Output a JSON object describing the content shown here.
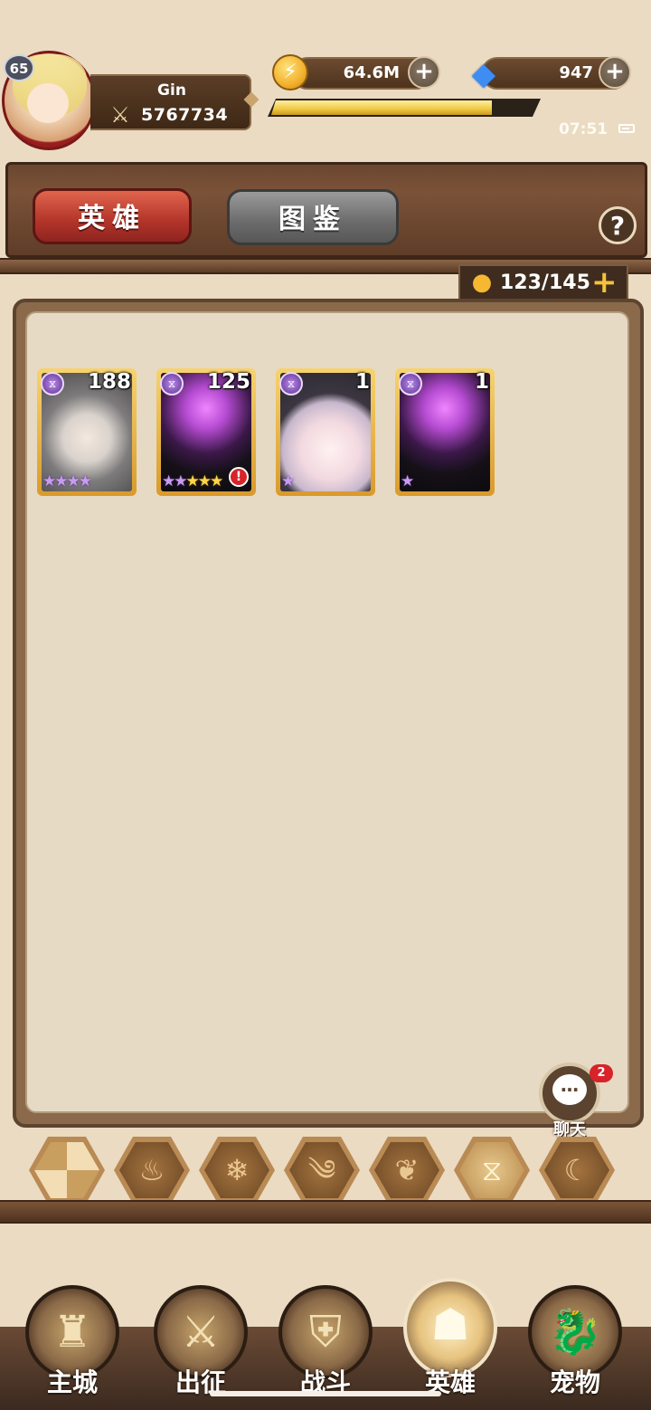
{
  "player": {
    "level": "65",
    "name": "Gin",
    "power": "5767734"
  },
  "currency": {
    "gold": "64.6M",
    "gems": "947"
  },
  "energy": {
    "fill_fraction": 0.84,
    "bar_color": "#f0c842"
  },
  "status": {
    "time": "07:51"
  },
  "tabs": [
    {
      "label": "英雄",
      "active": true
    },
    {
      "label": "图鉴",
      "active": false
    }
  ],
  "help_label": "?",
  "hero_count": "123/145",
  "heroes": [
    {
      "level": "188",
      "stars_purple": "★★★★",
      "stars_gold": "",
      "art": "silver",
      "alert": false
    },
    {
      "level": "125",
      "stars_purple": "★★",
      "stars_gold": "★★★",
      "art": "dark",
      "alert": true
    },
    {
      "level": "1",
      "stars_purple": "★",
      "stars_gold": "",
      "art": "witch",
      "alert": false
    },
    {
      "level": "1",
      "stars_purple": "★",
      "stars_gold": "",
      "art": "dark",
      "alert": false
    }
  ],
  "chat": {
    "label": "聊天",
    "badge": "2"
  },
  "element_filters": [
    {
      "icon": "all-elements-icon",
      "glyph": ""
    },
    {
      "icon": "fire-icon",
      "glyph": "♨"
    },
    {
      "icon": "ice-icon",
      "glyph": "❄"
    },
    {
      "icon": "wind-icon",
      "glyph": "༄"
    },
    {
      "icon": "nature-icon",
      "glyph": "❦"
    },
    {
      "icon": "light-icon",
      "glyph": "⧖",
      "selected": true
    },
    {
      "icon": "dark-icon",
      "glyph": "☾"
    }
  ],
  "nav": [
    {
      "label": "主城",
      "icon": "castle-icon",
      "glyph": "♜",
      "active": false
    },
    {
      "label": "出征",
      "icon": "crossed-axes-icon",
      "glyph": "⚔",
      "active": false
    },
    {
      "label": "战斗",
      "icon": "battle-shield-icon",
      "glyph": "⛨",
      "active": false
    },
    {
      "label": "英雄",
      "icon": "hooded-hero-icon",
      "glyph": "☗",
      "active": true
    },
    {
      "label": "宠物",
      "icon": "dragon-pet-icon",
      "glyph": "🐉",
      "active": false
    }
  ]
}
